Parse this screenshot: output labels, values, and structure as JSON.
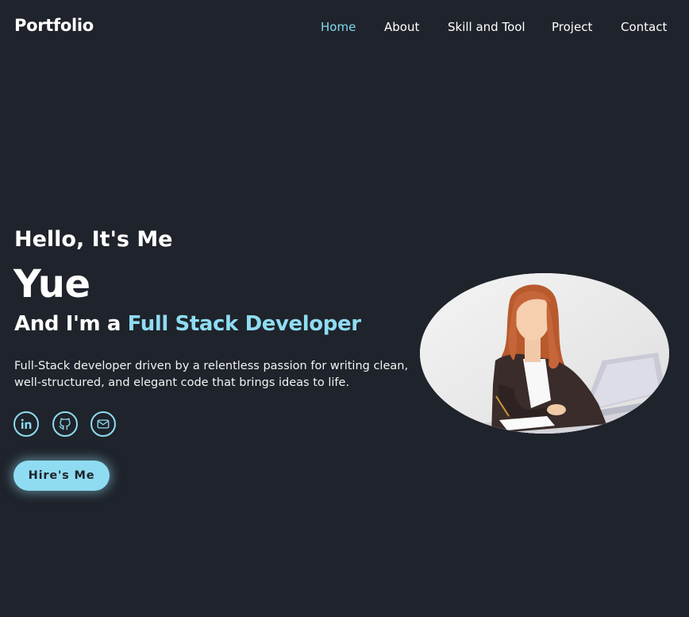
{
  "header": {
    "logo": "Portfolio",
    "nav": [
      {
        "label": "Home",
        "active": true
      },
      {
        "label": "About",
        "active": false
      },
      {
        "label": "Skill and Tool",
        "active": false
      },
      {
        "label": "Project",
        "active": false
      },
      {
        "label": "Contact",
        "active": false
      }
    ]
  },
  "hero": {
    "greeting": "Hello, It's Me",
    "name": "Yue",
    "role_prefix": "And I'm a ",
    "role_accent": "Full Stack Developer",
    "description": "Full-Stack developer driven by a relentless passion for writing clean, well-structured, and elegant code that brings ideas to life.",
    "socials": [
      {
        "icon": "linkedin-icon"
      },
      {
        "icon": "github-icon"
      },
      {
        "icon": "mail-icon"
      }
    ],
    "cta_label": "Hire's Me"
  },
  "colors": {
    "background": "#1f232b",
    "accent": "#8fdcf2",
    "text": "#ffffff"
  }
}
